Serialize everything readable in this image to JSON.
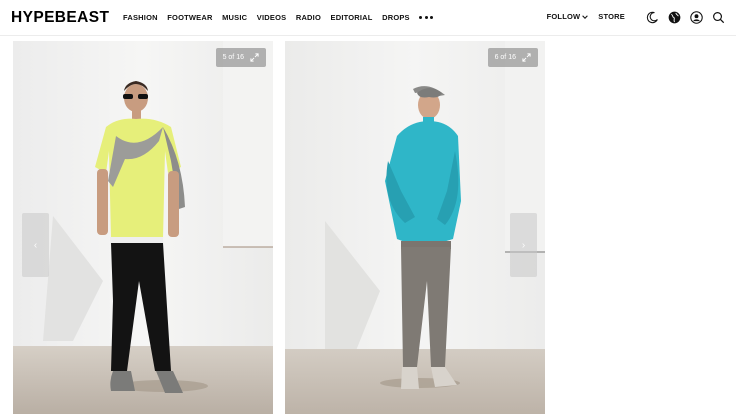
{
  "header": {
    "logo": "HYPEBEAST",
    "nav": [
      "FASHION",
      "FOOTWEAR",
      "MUSIC",
      "VIDEOS",
      "RADIO",
      "EDITORIAL",
      "DROPS"
    ],
    "more_icon": "more-dots-icon",
    "follow_label": "FOLLOW",
    "store_label": "STORE",
    "icons": [
      "moon-icon",
      "globe-icon",
      "user-icon",
      "search-icon"
    ]
  },
  "gallery": {
    "slides": [
      {
        "counter": "5 of 16",
        "expand_icon": "expand-icon",
        "prev_icon": "chevron-left-icon"
      },
      {
        "counter": "6 of 16",
        "expand_icon": "expand-icon",
        "next_icon": "chevron-right-icon"
      }
    ]
  },
  "colors": {
    "background": "#ffffff",
    "counter_badge": "#969696",
    "lime_tee": "#e6ef7a",
    "teal_jacket": "#2fb6c8"
  }
}
